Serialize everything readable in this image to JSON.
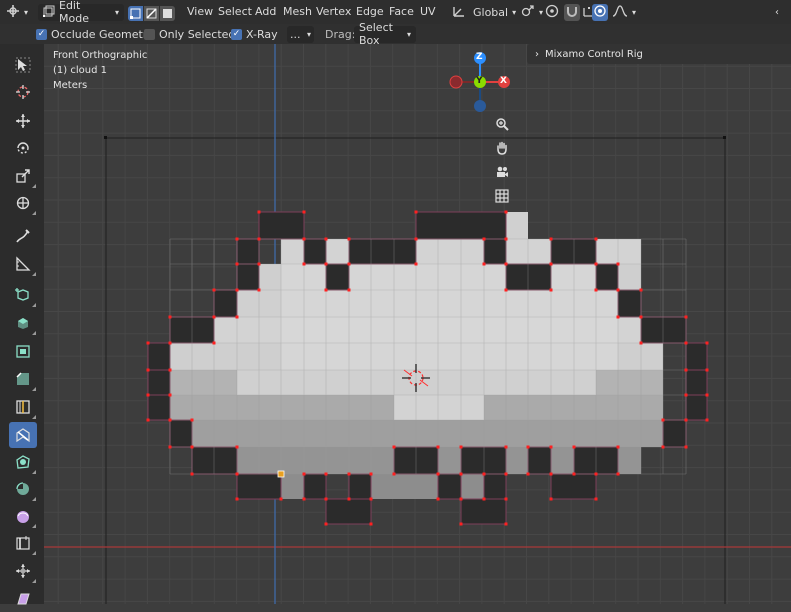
{
  "header": {
    "mode": "Edit Mode",
    "menus": [
      "View",
      "Select",
      "Add",
      "Mesh",
      "Vertex",
      "Edge",
      "Face",
      "UV"
    ],
    "orientation": "Global"
  },
  "toolbar_options": {
    "occlude_geometry": "Occlude Geometry",
    "only_selected": "Only Selected",
    "xray": "X-Ray",
    "dots": "...",
    "drag_label": "Drag:",
    "drag_value": "Select Box"
  },
  "viewport": {
    "view_name": "Front Orthographic",
    "object_name": "(1) cloud 1",
    "units": "Meters"
  },
  "gizmo": {
    "z": "Z",
    "y": "Y",
    "x": "X"
  },
  "rig_panel": {
    "label": "Mixamo Control Rig"
  },
  "colors": {
    "accent": "#4772b3",
    "header_bg": "#2e2e2e",
    "viewport_bg": "#3d3d3d",
    "axis_x": "#e2413f",
    "axis_y": "#8bdc00",
    "axis_z": "#2c8fff",
    "vertex": "#ff2020"
  },
  "tools": [
    "select-box",
    "cursor",
    "move",
    "rotate",
    "scale",
    "transform",
    "annotate",
    "measure",
    "add-cube",
    "extrude-region",
    "inset-faces",
    "bevel",
    "loop-cut",
    "knife",
    "poly-build",
    "spin",
    "smooth",
    "edge-slide",
    "shrink-fatten",
    "shear"
  ]
}
